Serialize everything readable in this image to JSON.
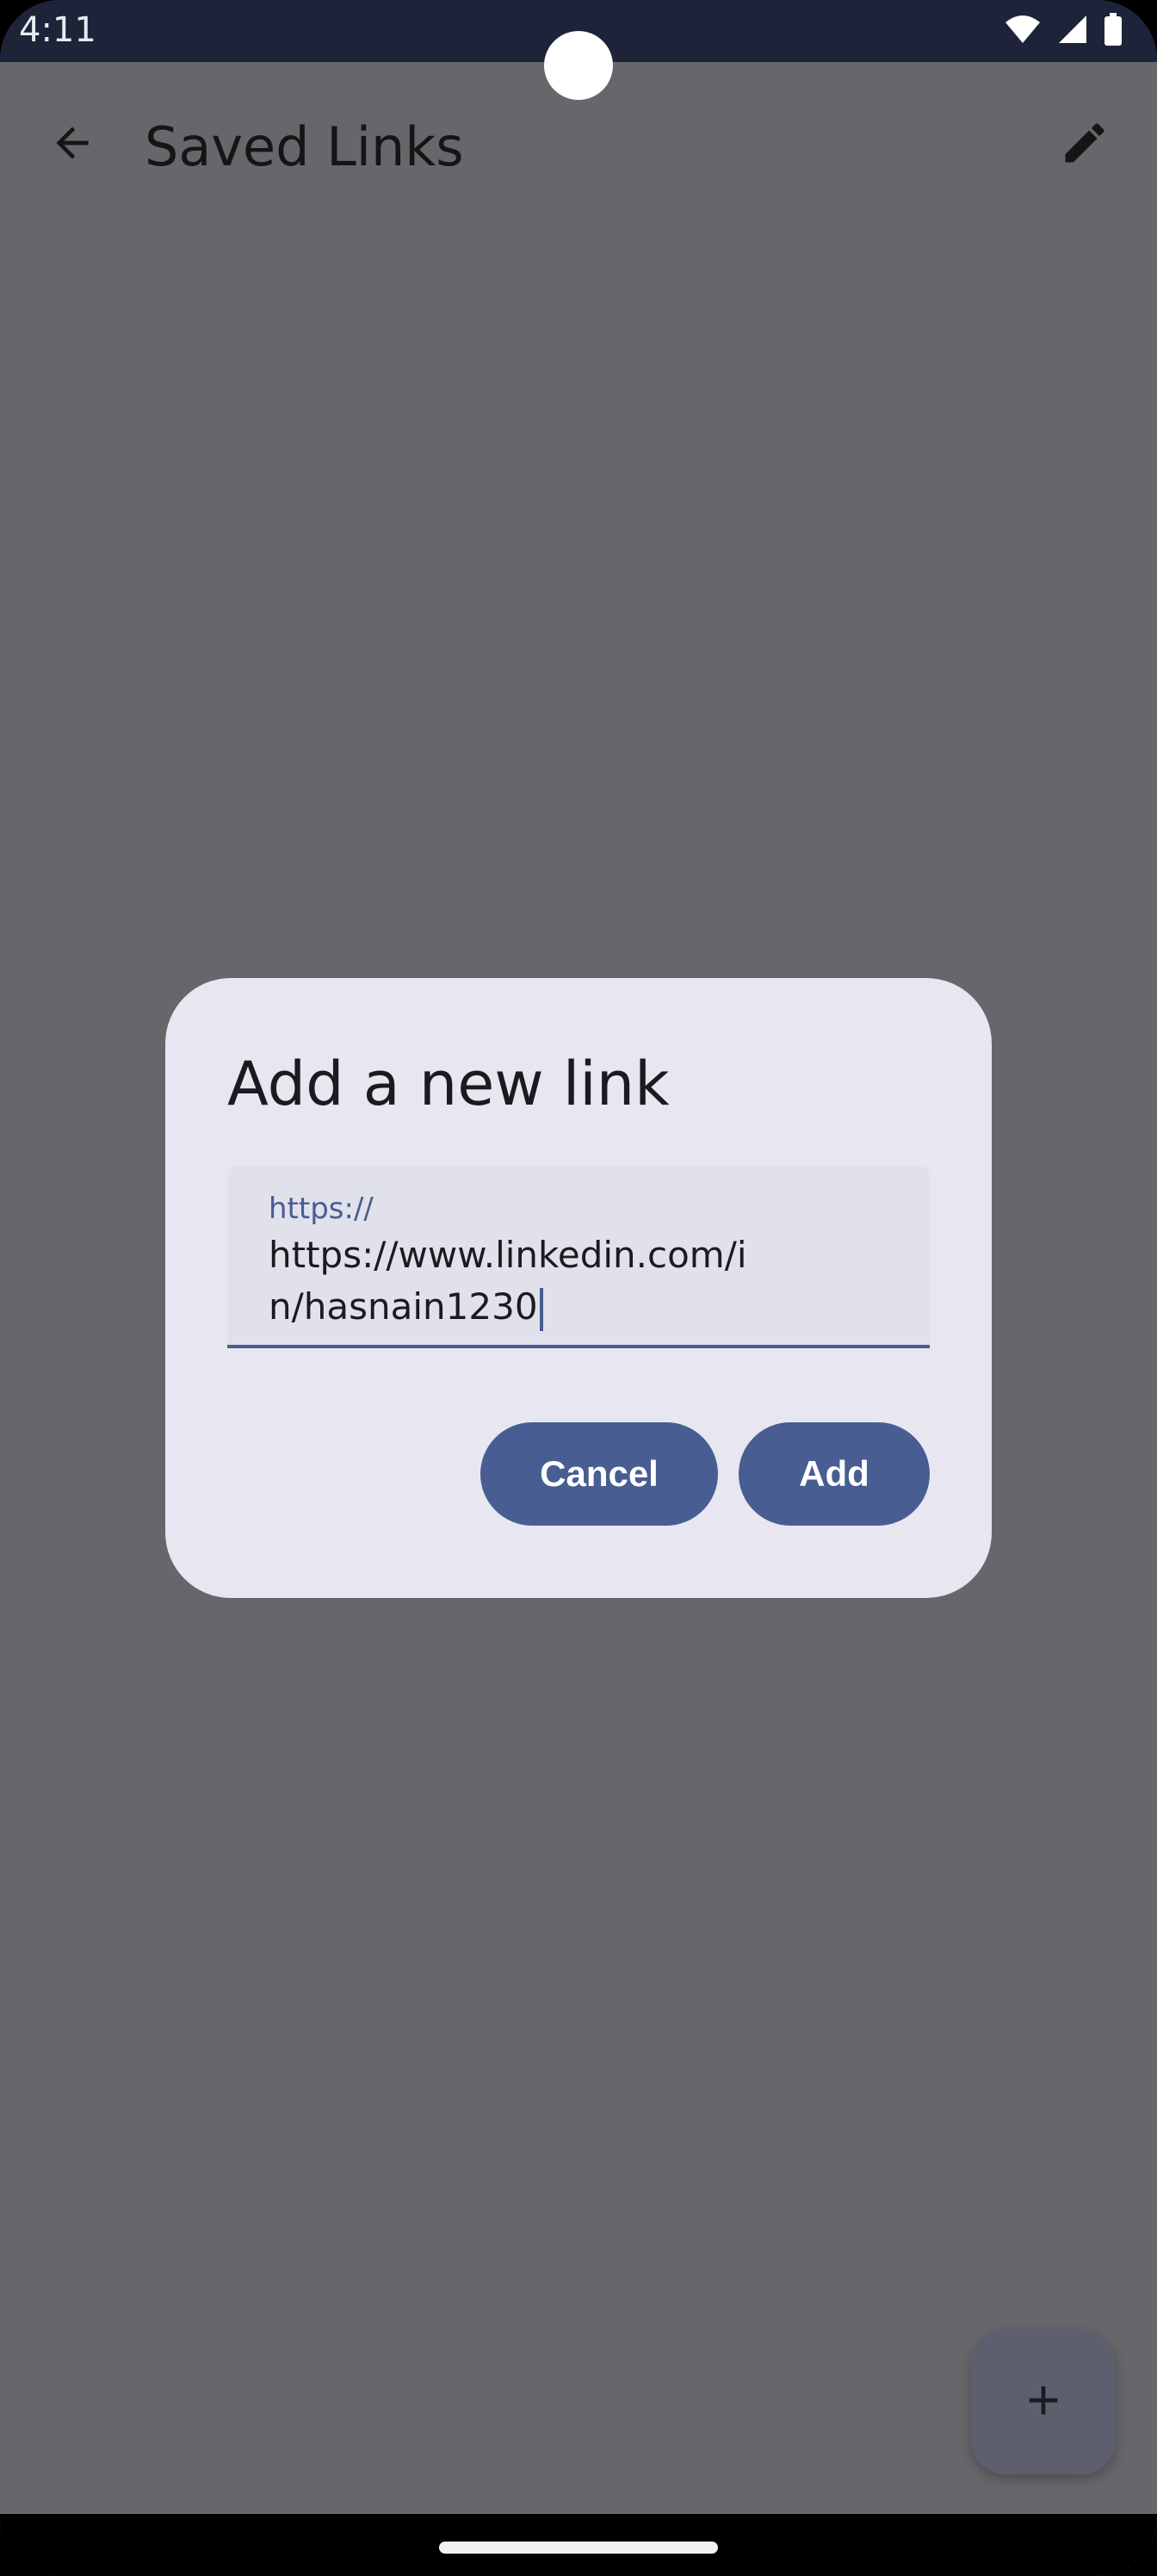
{
  "status_bar": {
    "time": "4:11",
    "icons": [
      "wifi-icon",
      "cellular-signal-icon",
      "battery-icon"
    ]
  },
  "app_bar": {
    "title": "Saved Links",
    "back_icon": "arrow-back-icon",
    "edit_icon": "pencil-edit-icon"
  },
  "dialog": {
    "title": "Add a new link",
    "field": {
      "label": "https://",
      "value": "https://www.linkedin.com/in/hasnain1230"
    },
    "cancel_label": "Cancel",
    "add_label": "Add"
  },
  "fab": {
    "icon": "plus-icon"
  },
  "colors": {
    "primary": "#485d92",
    "scrim": "#68666a",
    "dialog_surface": "#e8e7f1",
    "status_bar": "#1d2439"
  }
}
